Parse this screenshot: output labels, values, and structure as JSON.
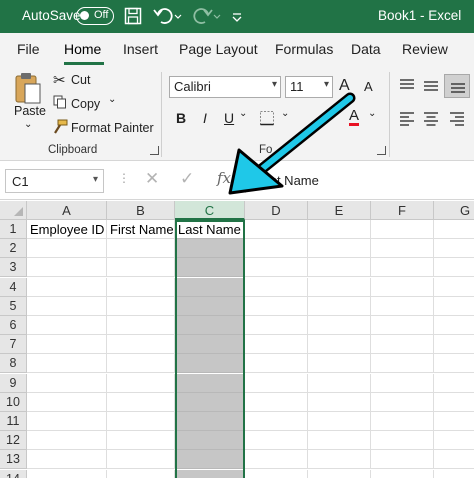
{
  "titlebar": {
    "autosave_label": "AutoSave",
    "autosave_state": "Off",
    "doc_title": "Book1  -  Excel"
  },
  "tabs": [
    "File",
    "Home",
    "Insert",
    "Page Layout",
    "Formulas",
    "Data",
    "Review"
  ],
  "active_tab": "Home",
  "ribbon": {
    "paste_label": "Paste",
    "cut_label": "Cut",
    "copy_label": "Copy",
    "format_painter_label": "Format Painter",
    "clipboard_group": "Clipboard",
    "font_group_partial": "Fo",
    "font_name": "Calibri",
    "font_size": "11",
    "bold": "B",
    "italic": "I",
    "underline": "U",
    "grow_font": "A",
    "shrink_font": "A",
    "font_color_letter": "A",
    "font_color": "#e81123"
  },
  "formula_bar": {
    "name_box": "C1",
    "fx": "fx",
    "content": "Last Name"
  },
  "grid": {
    "columns": [
      "A",
      "B",
      "C",
      "D",
      "E",
      "F",
      "G"
    ],
    "selected_column": "C",
    "rows": [
      "1",
      "2",
      "3",
      "4",
      "5",
      "6",
      "7",
      "8",
      "9",
      "10",
      "11",
      "12",
      "13",
      "14"
    ],
    "row1": [
      "Employee ID",
      "First Name",
      "Last Name",
      "",
      "",
      "",
      ""
    ]
  },
  "colors": {
    "excel_green": "#217346",
    "selection_gray": "#c6c6c6",
    "arrow_fill": "#1fc8e8",
    "arrow_outline": "#000000"
  }
}
